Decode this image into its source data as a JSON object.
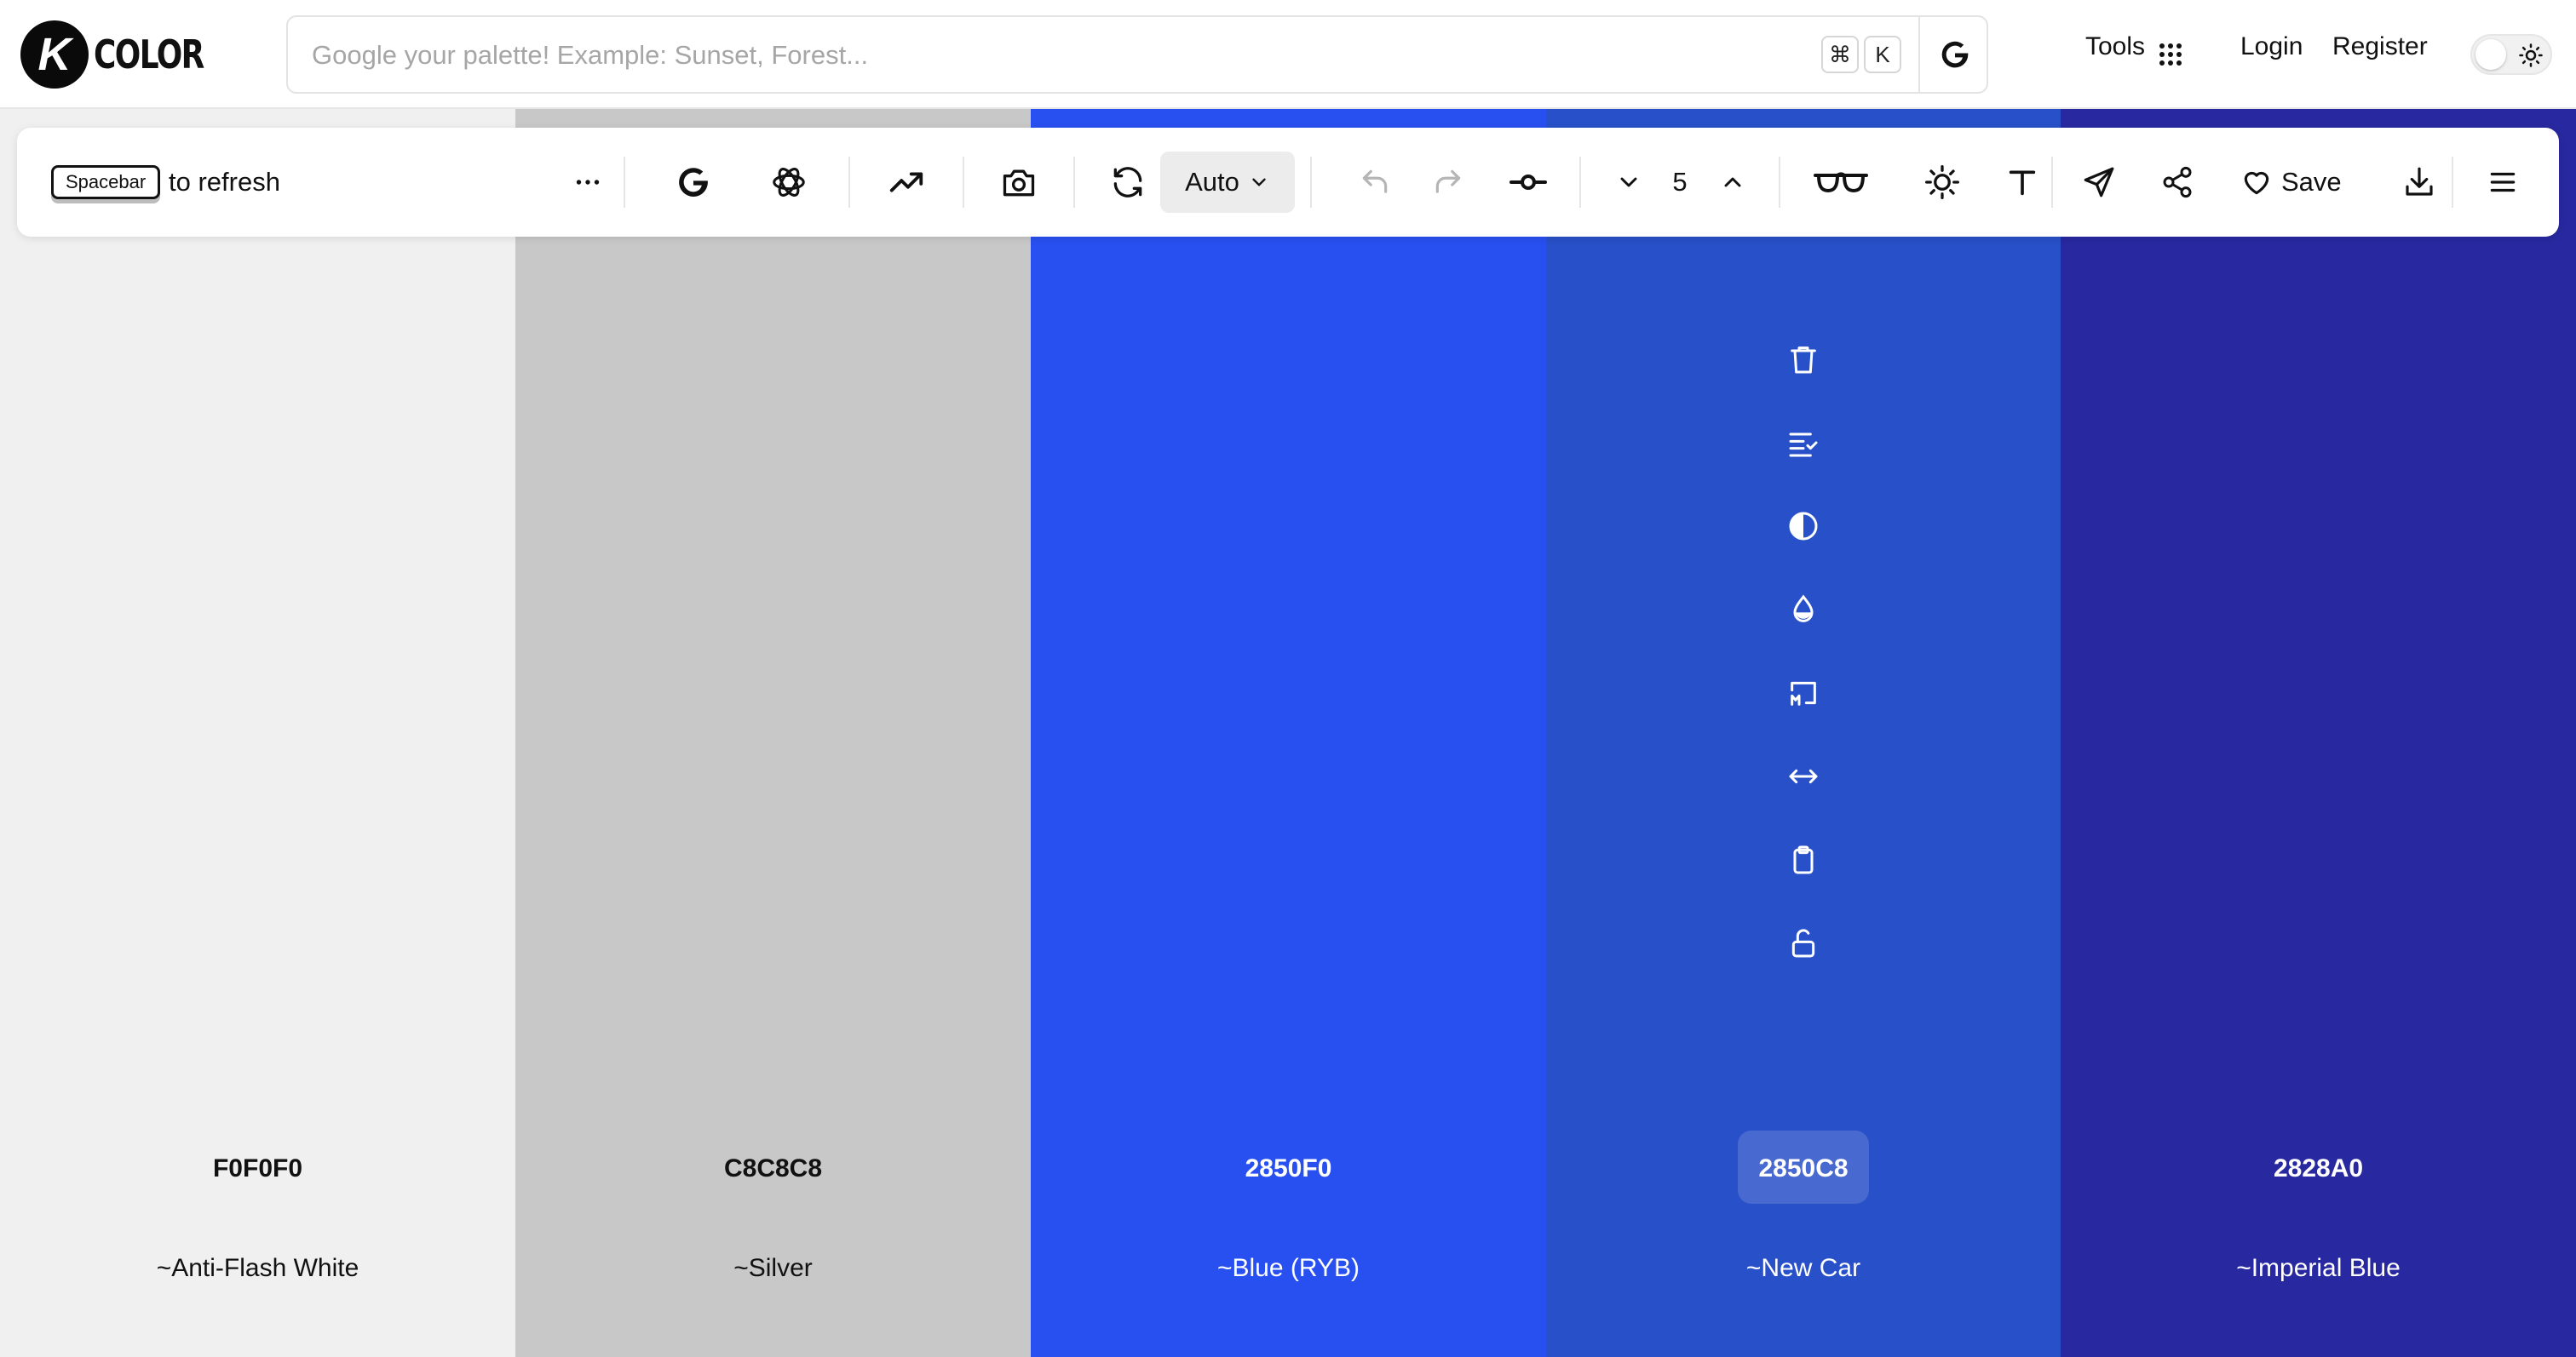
{
  "app": {
    "logo_letter": "K",
    "logo_word": "COLOR"
  },
  "search": {
    "placeholder": "Google your palette! Example: Sunset, Forest...",
    "value": "",
    "shortcut_keys": [
      "⌘",
      "K"
    ]
  },
  "nav": {
    "tools": "Tools",
    "login": "Login",
    "register": "Register"
  },
  "toolbar": {
    "spacebar_key": "Spacebar",
    "refresh_text": "to refresh",
    "mode": "Auto",
    "color_count": "5",
    "save": "Save"
  },
  "palette": [
    {
      "hex": "F0F0F0",
      "name": "~Anti-Flash White",
      "bg": "#F0F0F0",
      "text": "#111111"
    },
    {
      "hex": "C8C8C8",
      "name": "~Silver",
      "bg": "#C8C8C8",
      "text": "#111111"
    },
    {
      "hex": "2850F0",
      "name": "~Blue (RYB)",
      "bg": "#2850F0",
      "text": "#FFFFFF"
    },
    {
      "hex": "2850C8",
      "name": "~New Car",
      "bg": "#2850C8",
      "text": "#FFFFFF"
    },
    {
      "hex": "2828A0",
      "name": "~Imperial Blue",
      "bg": "#2828A0",
      "text": "#FFFFFF"
    }
  ],
  "hovered_column_actions": [
    "trash-icon",
    "list-check-icon",
    "contrast-icon",
    "drop-icon",
    "markdown-icon",
    "arrows-horizontal-icon",
    "clipboard-icon",
    "unlock-icon"
  ]
}
